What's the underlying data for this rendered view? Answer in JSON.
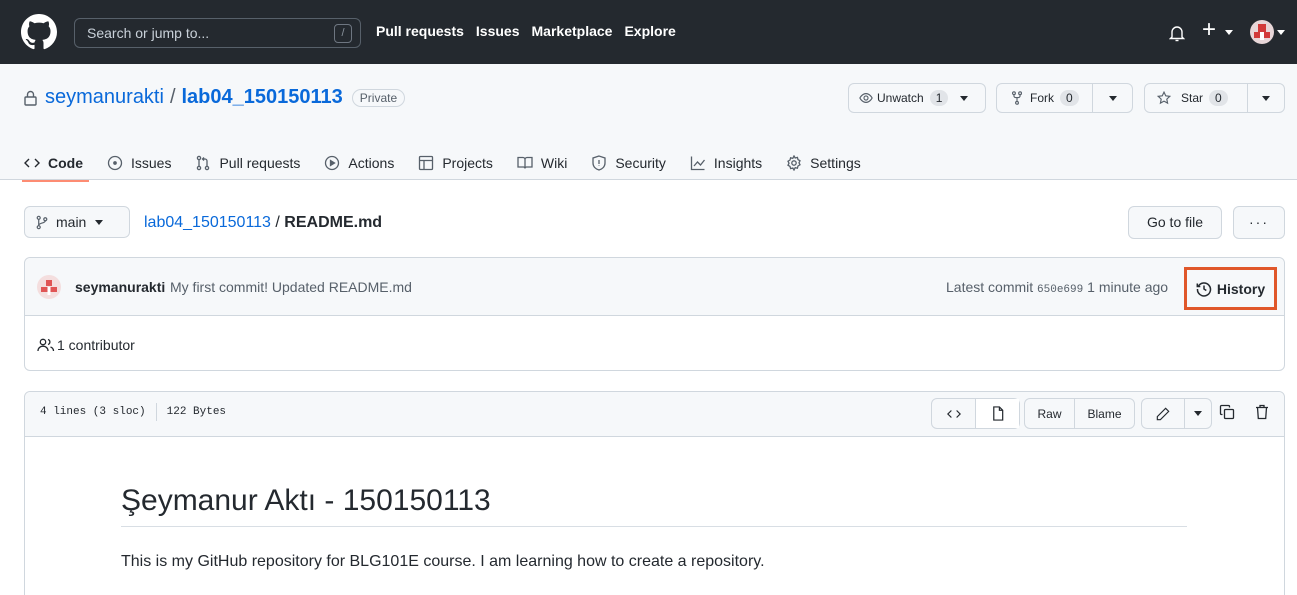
{
  "header": {
    "search_placeholder": "Search or jump to...",
    "search_shortcut": "/",
    "nav": [
      "Pull requests",
      "Issues",
      "Marketplace",
      "Explore"
    ]
  },
  "repo": {
    "owner": "seymanurakti",
    "separator": "/",
    "name": "lab04_150150113",
    "visibility": "Private",
    "unwatch_label": "Unwatch",
    "watch_count": "1",
    "fork_label": "Fork",
    "fork_count": "0",
    "star_label": "Star",
    "star_count": "0"
  },
  "tabs": [
    {
      "label": "Code",
      "icon": "code-icon",
      "active": true
    },
    {
      "label": "Issues",
      "icon": "issue-icon"
    },
    {
      "label": "Pull requests",
      "icon": "pull-request-icon"
    },
    {
      "label": "Actions",
      "icon": "play-icon"
    },
    {
      "label": "Projects",
      "icon": "table-icon"
    },
    {
      "label": "Wiki",
      "icon": "book-icon"
    },
    {
      "label": "Security",
      "icon": "shield-icon"
    },
    {
      "label": "Insights",
      "icon": "graph-icon"
    },
    {
      "label": "Settings",
      "icon": "gear-icon"
    }
  ],
  "filenav": {
    "branch": "main",
    "breadcrumb_repo": "lab04_150150113",
    "breadcrumb_sep": " / ",
    "breadcrumb_file": "README.md",
    "go_to_file": "Go to file",
    "more": "···"
  },
  "commit": {
    "author": "seymanurakti",
    "message": "My first commit! Updated README.md",
    "latest_label": "Latest commit",
    "sha": "650e699",
    "time": "1 minute ago",
    "history_label": "History",
    "contributors": "1 contributor"
  },
  "file": {
    "lines": "4 lines (3 sloc)",
    "size": "122 Bytes",
    "raw": "Raw",
    "blame": "Blame"
  },
  "readme": {
    "heading": "Şeymanur Aktı - 150150113",
    "paragraph": "This is my GitHub repository for BLG101E course. I am learning how to create a repository."
  },
  "colors": {
    "header_bg": "#24292f",
    "link": "#0969da",
    "active_tab_underline": "#fd8c73",
    "highlight_box": "#e0572a"
  }
}
